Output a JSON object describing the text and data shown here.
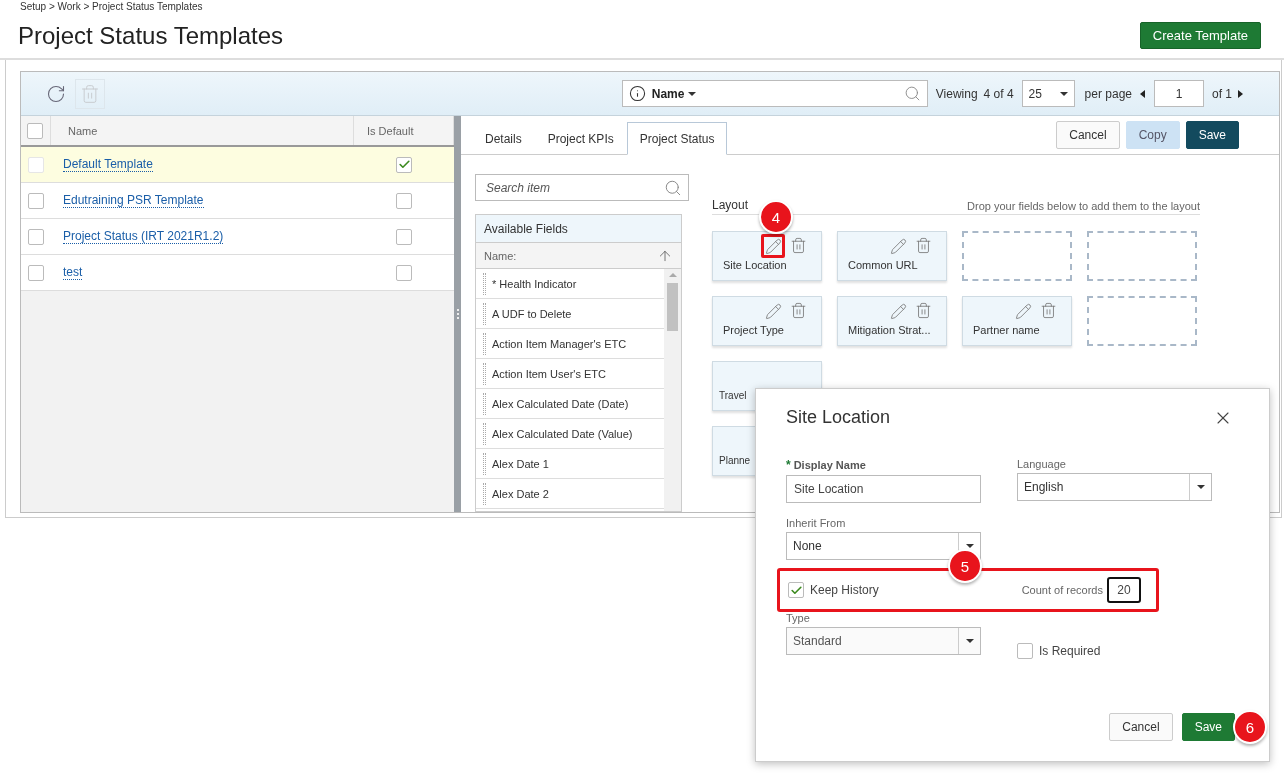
{
  "breadcrumb": "Setup > Work > Project Status Templates",
  "title": "Project Status Templates",
  "create_button": "Create Template",
  "toolbar": {
    "filter_label": "Name",
    "viewing_label": "Viewing",
    "viewing_count": "4 of 4",
    "page_size": "25",
    "per_page": "per page",
    "page": "1",
    "page_total": "of 1"
  },
  "templates": {
    "all_selected": false,
    "columns": [
      "Name",
      "Is Default"
    ],
    "rows": [
      {
        "name": "Default Template",
        "is_default": true,
        "selected": true
      },
      {
        "name": "Edutraining PSR Template",
        "is_default": false,
        "selected": false
      },
      {
        "name": "Project Status (IRT 2021R1.2)",
        "is_default": false,
        "selected": false
      },
      {
        "name": "test",
        "is_default": false,
        "selected": false
      }
    ]
  },
  "tabs": [
    {
      "label": "Details",
      "selected": false
    },
    {
      "label": "Project KPIs",
      "selected": false
    },
    {
      "label": "Project Status",
      "selected": true
    }
  ],
  "actions": [
    {
      "label": "Cancel",
      "kind": "secondary"
    },
    {
      "label": "Copy",
      "kind": "disabled"
    },
    {
      "label": "Save",
      "kind": "primary"
    }
  ],
  "fields_panel": {
    "search_placeholder": "Search item",
    "title": "Available Fields",
    "sort_label": "Name:",
    "items": [
      "* Health Indicator",
      "A UDF to Delete",
      "Action Item Manager's ETC",
      "Action Item User's ETC",
      "Alex Calculated Date (Date)",
      "Alex Calculated Date (Value)",
      "Alex Date 1",
      "Alex Date 2"
    ]
  },
  "layout": {
    "title": "Layout",
    "hint": "Drop your fields below to add them to the layout",
    "cards": [
      {
        "kind": "field",
        "label": "Site Location",
        "highlighted": true,
        "step": "4"
      },
      {
        "kind": "field",
        "label": "Common URL",
        "highlighted": false
      },
      {
        "kind": "empty"
      },
      {
        "kind": "empty"
      },
      {
        "kind": "field",
        "label": "Project Type",
        "highlighted": false
      },
      {
        "kind": "field",
        "label": "Mitigation Strat...",
        "highlighted": false
      },
      {
        "kind": "field",
        "label": "Partner name",
        "highlighted": false
      },
      {
        "kind": "empty"
      },
      {
        "kind": "covered",
        "label": "Travel"
      },
      {
        "kind": "covered",
        "label": "Planne"
      }
    ]
  },
  "dialog": {
    "title": "Site Location",
    "display_name": {
      "required_mark": "*",
      "label": "Display Name",
      "value": "Site Location"
    },
    "language": {
      "label": "Language",
      "value": "English"
    },
    "inherit_from": {
      "label": "Inherit From",
      "value": "None"
    },
    "keep_history": {
      "label": "Keep History",
      "checked": true,
      "step": "5"
    },
    "count_of_records": {
      "label": "Count of records",
      "value": "20"
    },
    "type": {
      "label": "Type",
      "value": "Standard",
      "disabled": true
    },
    "is_required": {
      "label": "Is Required",
      "checked": false
    },
    "buttons": [
      {
        "label": "Cancel",
        "kind": "secondary"
      },
      {
        "label": "Save",
        "kind": "primary",
        "step": "6"
      }
    ]
  }
}
